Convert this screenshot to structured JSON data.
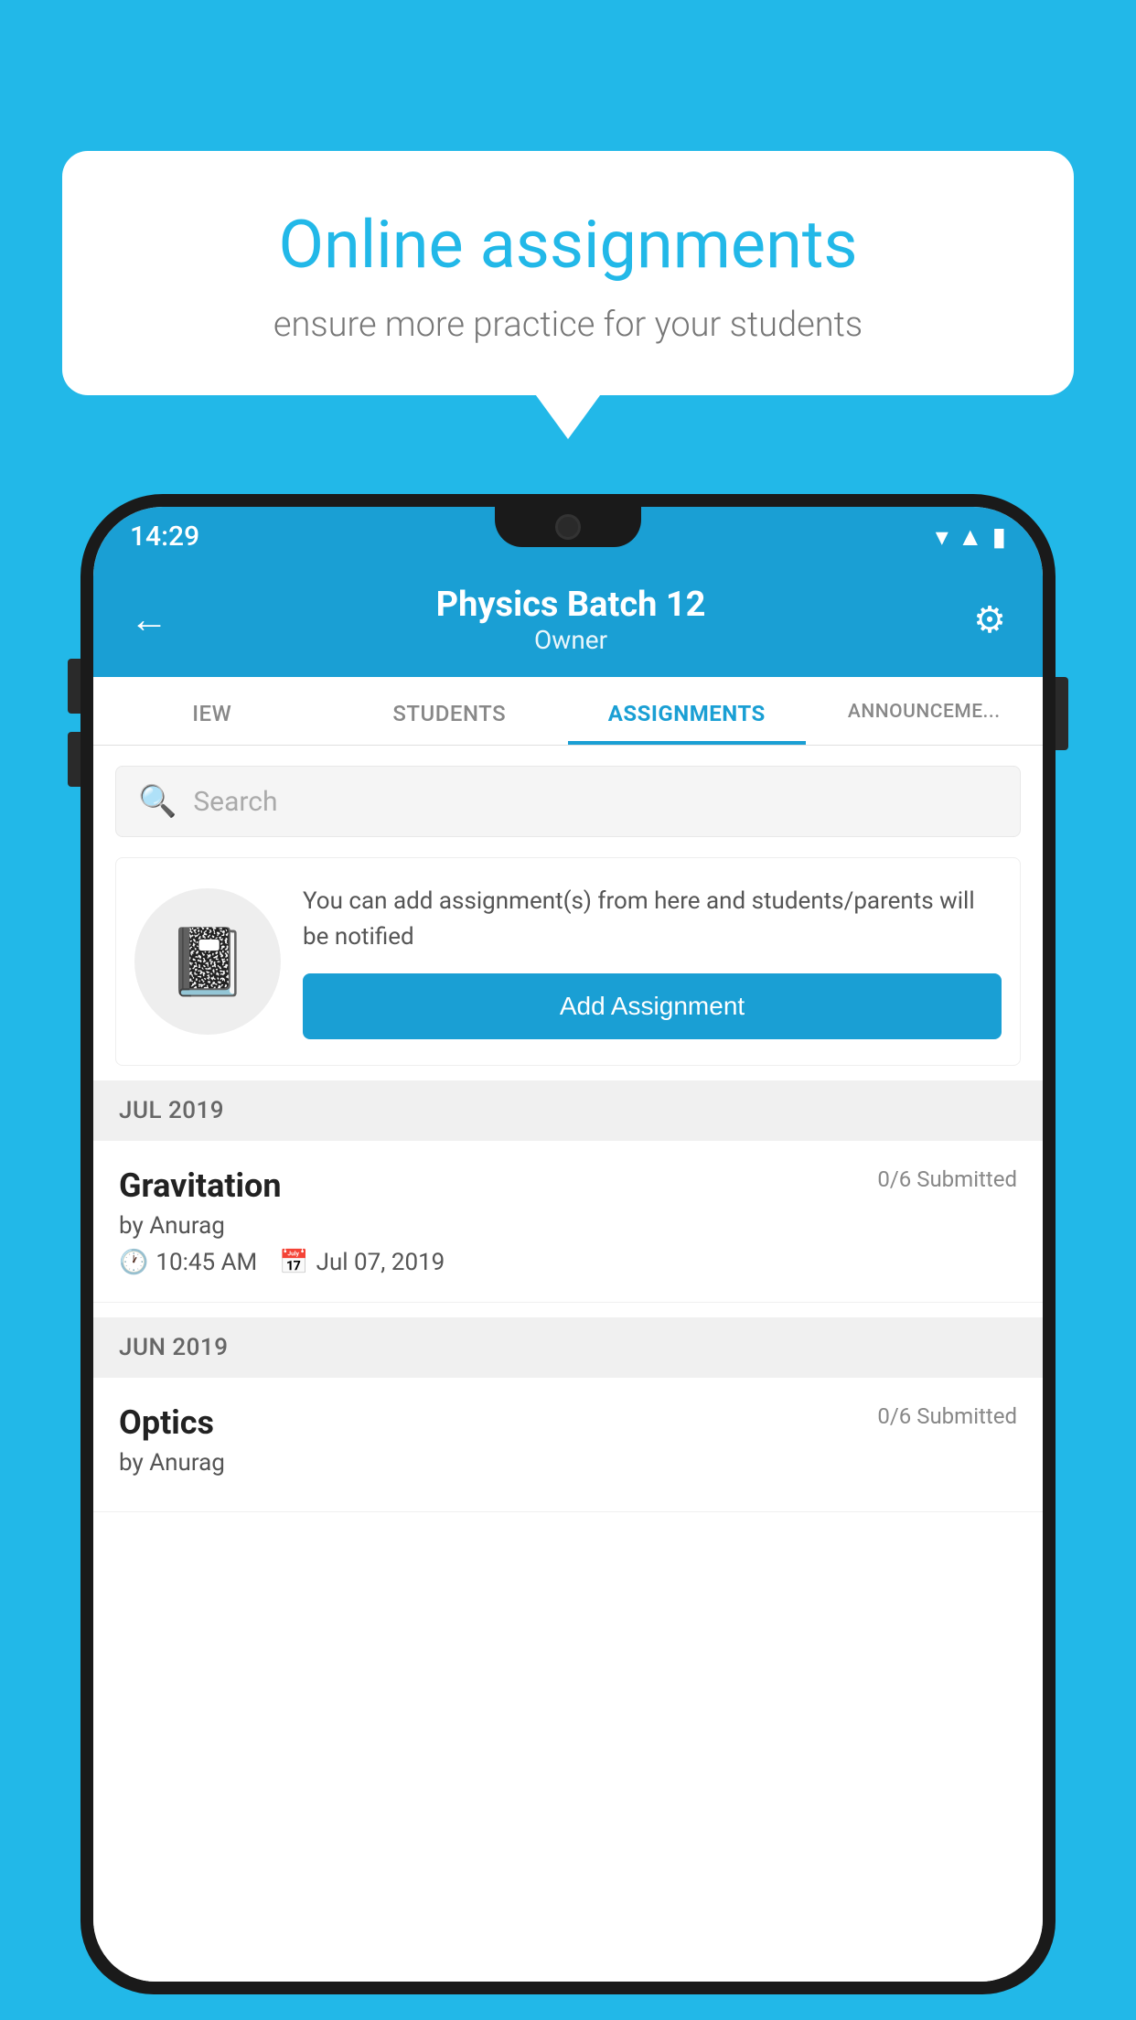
{
  "background_color": "#22b8e8",
  "speech_bubble": {
    "title": "Online assignments",
    "subtitle": "ensure more practice for your students"
  },
  "phone": {
    "status_bar": {
      "time": "14:29",
      "icons": [
        "wifi",
        "signal",
        "battery"
      ]
    },
    "header": {
      "title": "Physics Batch 12",
      "subtitle": "Owner",
      "back_label": "←",
      "settings_label": "⚙"
    },
    "tabs": [
      {
        "label": "IEW",
        "active": false
      },
      {
        "label": "STUDENTS",
        "active": false
      },
      {
        "label": "ASSIGNMENTS",
        "active": true
      },
      {
        "label": "ANNOUNCEMENTS",
        "active": false
      }
    ],
    "search": {
      "placeholder": "Search"
    },
    "promo": {
      "text": "You can add assignment(s) from here and students/parents will be notified",
      "button_label": "Add Assignment"
    },
    "sections": [
      {
        "label": "JUL 2019",
        "assignments": [
          {
            "name": "Gravitation",
            "submitted": "0/6 Submitted",
            "by": "by Anurag",
            "time": "10:45 AM",
            "date": "Jul 07, 2019"
          }
        ]
      },
      {
        "label": "JUN 2019",
        "assignments": [
          {
            "name": "Optics",
            "submitted": "0/6 Submitted",
            "by": "by Anurag",
            "time": "",
            "date": ""
          }
        ]
      }
    ]
  }
}
